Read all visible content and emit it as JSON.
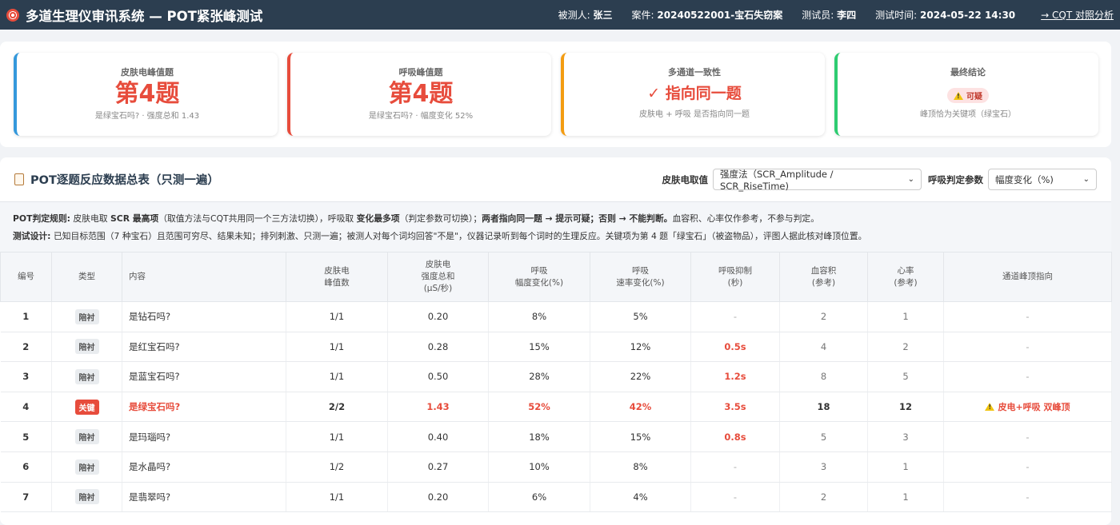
{
  "header": {
    "title": "多道生理仪审讯系统 — POT紧张峰测试",
    "subject_label": "被测人:",
    "subject": "张三",
    "case_label": "案件:",
    "case": "20240522001-宝石失窃案",
    "tester_label": "测试员:",
    "tester": "李四",
    "time_label": "测试时间:",
    "time": "2024-05-22 14:30",
    "link": "→ CQT 对照分析"
  },
  "cards": [
    {
      "label": "皮肤电峰值题",
      "value": "第4题",
      "sub": "是绿宝石吗? · 强度总和 1.43"
    },
    {
      "label": "呼吸峰值题",
      "value": "第4题",
      "sub": "是绿宝石吗? · 幅度变化 52%"
    },
    {
      "label": "多通道一致性",
      "value": "✓ 指向同一题",
      "sub": "皮肤电 + 呼吸 是否指向同一题"
    },
    {
      "label": "最终结论",
      "badge": "可疑",
      "sub": "峰顶恰为关键项（绿宝石）"
    }
  ],
  "panel": {
    "title": "POT逐题反应数据总表（只测一遍）",
    "scr_label": "皮肤电取值",
    "scr_select": "强度法（SCR_Amplitude / SCR_RiseTime)",
    "resp_label": "呼吸判定参数",
    "resp_select": "幅度变化（%)"
  },
  "rules": {
    "line1_label": "POT判定规则:",
    "line1_a": " 皮肤电取 ",
    "line1_b": "SCR 最高项",
    "line1_c": "（取值方法与CQT共用同一个三方法切换），呼吸取 ",
    "line1_d": "变化最多项",
    "line1_e": "（判定参数可切换）；",
    "line1_f": "两者指向同一题 → 提示可疑；否则 → 不能判断。",
    "line1_g": "血容积、心率仅作参考，不参与判定。",
    "line2_label": "测试设计:",
    "line2_text": " 已知目标范围（7 种宝石）且范围可穷尽、结果未知；排列刺激、只测一遍；被测人对每个词均回答\"不是\"，仪器记录听到每个词时的生理反应。关键项为第 4 题「绿宝石」（被盗物品），评图人据此核对峰顶位置。"
  },
  "table": {
    "headers": [
      "编号",
      "类型",
      "内容",
      "皮肤电\n峰值数",
      "皮肤电\n强度总和\n(μS/秒)",
      "呼吸\n幅度变化(%)",
      "呼吸\n速率变化(%)",
      "呼吸抑制\n(秒)",
      "血容积\n(参考)",
      "心率\n(参考)",
      "通道峰顶指向"
    ],
    "rows": [
      {
        "no": "1",
        "type": "陪衬",
        "content": "是钻石吗?",
        "peaks": "1/1",
        "scr": "0.20",
        "amp": "8%",
        "rate": "5%",
        "supp": "-",
        "bv": "2",
        "hr": "1",
        "flag": "-"
      },
      {
        "no": "2",
        "type": "陪衬",
        "content": "是红宝石吗?",
        "peaks": "1/1",
        "scr": "0.28",
        "amp": "15%",
        "rate": "12%",
        "supp": "0.5s",
        "bv": "4",
        "hr": "2",
        "flag": "-"
      },
      {
        "no": "3",
        "type": "陪衬",
        "content": "是蓝宝石吗?",
        "peaks": "1/1",
        "scr": "0.50",
        "amp": "28%",
        "rate": "22%",
        "supp": "1.2s",
        "bv": "8",
        "hr": "5",
        "flag": "-"
      },
      {
        "no": "4",
        "type": "关键",
        "content": "是绿宝石吗?",
        "peaks": "2/2",
        "scr": "1.43",
        "amp": "52%",
        "rate": "42%",
        "supp": "3.5s",
        "bv": "18",
        "hr": "12",
        "flag": "皮电+呼吸 双峰顶"
      },
      {
        "no": "5",
        "type": "陪衬",
        "content": "是玛瑙吗?",
        "peaks": "1/1",
        "scr": "0.40",
        "amp": "18%",
        "rate": "15%",
        "supp": "0.8s",
        "bv": "5",
        "hr": "3",
        "flag": "-"
      },
      {
        "no": "6",
        "type": "陪衬",
        "content": "是水晶吗?",
        "peaks": "1/2",
        "scr": "0.27",
        "amp": "10%",
        "rate": "8%",
        "supp": "-",
        "bv": "3",
        "hr": "1",
        "flag": "-"
      },
      {
        "no": "7",
        "type": "陪衬",
        "content": "是翡翠吗?",
        "peaks": "1/1",
        "scr": "0.20",
        "amp": "6%",
        "rate": "4%",
        "supp": "-",
        "bv": "2",
        "hr": "1",
        "flag": "-"
      }
    ]
  }
}
